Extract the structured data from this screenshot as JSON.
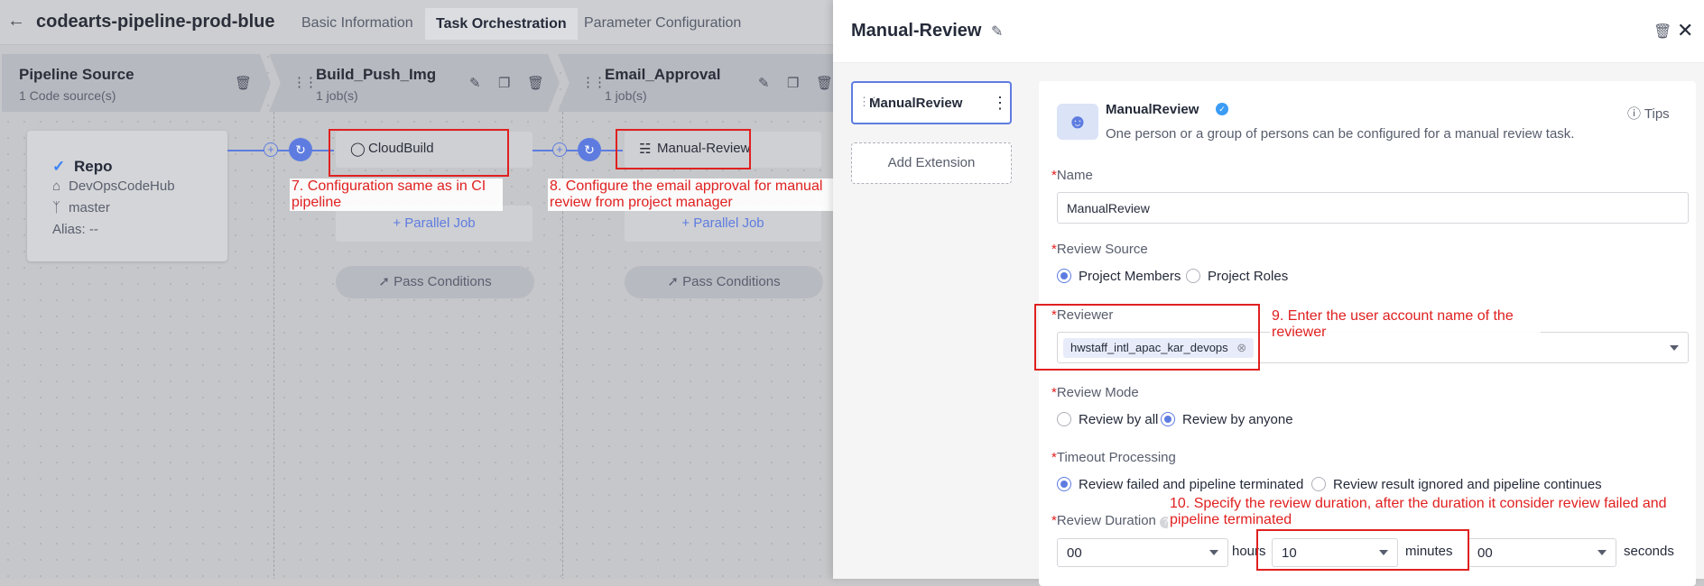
{
  "header": {
    "back_icon": "arrow-left-icon",
    "pipeline_name": "codearts-pipeline-prod-blue",
    "tabs": [
      "Basic Information",
      "Task Orchestration",
      "Parameter Configuration"
    ]
  },
  "stages": [
    {
      "name": "Pipeline Source",
      "sub": "1 Code source(s)"
    },
    {
      "name": "Build_Push_Img",
      "sub": "1 job(s)"
    },
    {
      "name": "Email_Approval",
      "sub": "1 job(s)"
    }
  ],
  "repo": {
    "title": "Repo",
    "host": "DevOpsCodeHub",
    "branch": "master",
    "alias": "Alias:  --"
  },
  "jobs": [
    {
      "name": "CloudBuild",
      "parallel": "+ Parallel Job",
      "pass": "Pass Conditions"
    },
    {
      "name": "Manual-Review",
      "parallel": "+ Parallel Job",
      "pass": "Pass Conditions"
    }
  ],
  "annotations": {
    "a7": "7. Configuration same as in CI pipeline",
    "a8": "8. Configure the email approval for manual review from project manager",
    "a9": "9. Enter the user account name of the reviewer",
    "a10": "10. Specify the review duration, after the duration it consider review failed and pipeline terminated"
  },
  "panel": {
    "title": "Manual-Review",
    "side_item": "ManualReview",
    "add_extension": "Add Extension",
    "ext_name": "ManualReview",
    "ext_desc": "One person or a group of persons can be configured for a manual review task.",
    "tips": "Tips",
    "name_label": "Name",
    "name_value": "ManualReview",
    "review_source_label": "Review Source",
    "source_options": [
      "Project Members",
      "Project Roles"
    ],
    "reviewer_label": "Reviewer",
    "reviewer_tag": "hwstaff_intl_apac_kar_devops",
    "review_mode_label": "Review Mode",
    "mode_options": [
      "Review by all",
      "Review by anyone"
    ],
    "timeout_label": "Timeout Processing",
    "timeout_options": [
      "Review failed and pipeline terminated",
      "Review result ignored and pipeline continues"
    ],
    "duration_label": "Review Duration",
    "hours": "00",
    "hours_unit": "hours",
    "minutes": "10",
    "minutes_unit": "minutes",
    "seconds": "00",
    "seconds_unit": "seconds"
  },
  "colors": {
    "accent": "#5e7ce0",
    "annotation": "#e02020"
  }
}
